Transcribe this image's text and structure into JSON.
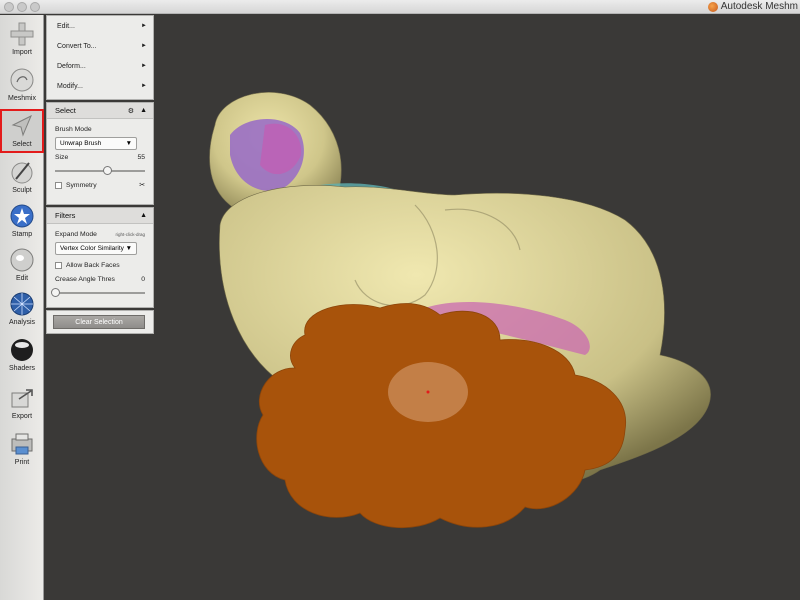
{
  "window": {
    "title": "Autodesk Meshm"
  },
  "toolbar": {
    "selected": "Select",
    "items": [
      {
        "label": "Import",
        "icon": "plus-icon"
      },
      {
        "label": "Meshmix",
        "icon": "sphere-icon"
      },
      {
        "label": "Select",
        "icon": "arrow-pointer-icon"
      },
      {
        "label": "Sculpt",
        "icon": "brush-sphere-icon"
      },
      {
        "label": "Stamp",
        "icon": "stamp-sphere-icon"
      },
      {
        "label": "Edit",
        "icon": "edit-sphere-icon"
      },
      {
        "label": "Analysis",
        "icon": "mesh-sphere-icon"
      },
      {
        "label": "Shaders",
        "icon": "shaded-sphere-icon"
      },
      {
        "label": "Export",
        "icon": "export-arrow-icon"
      },
      {
        "label": "Print",
        "icon": "printer-icon"
      }
    ]
  },
  "menu": {
    "items": [
      {
        "label": "Edit..."
      },
      {
        "label": "Convert To..."
      },
      {
        "label": "Deform..."
      },
      {
        "label": "Modify..."
      }
    ]
  },
  "select_panel": {
    "title": "Select",
    "brush_mode_label": "Brush Mode",
    "brush_mode_value": "Unwrap Brush",
    "size_label": "Size",
    "size_value": "55",
    "size_fraction": 0.58,
    "symmetry_label": "Symmetry",
    "symmetry_checked": false
  },
  "filters_panel": {
    "title": "Filters",
    "expand_mode_label": "Expand Mode",
    "expand_mode_hint": "right-click-drag",
    "expand_mode_value": "Vertex Color Similarity",
    "allow_back_faces_label": "Allow Back Faces",
    "allow_back_faces_checked": false,
    "crease_label": "Crease Angle Thres",
    "crease_value": "0",
    "crease_fraction": 0.0
  },
  "clear_button": {
    "label": "Clear Selection"
  },
  "colors": {
    "viewport_bg": "#3a3937",
    "mesh_tan": "#d6cd8e",
    "selection_orange": "#a8530b",
    "accent_red": "#e31b1b"
  }
}
